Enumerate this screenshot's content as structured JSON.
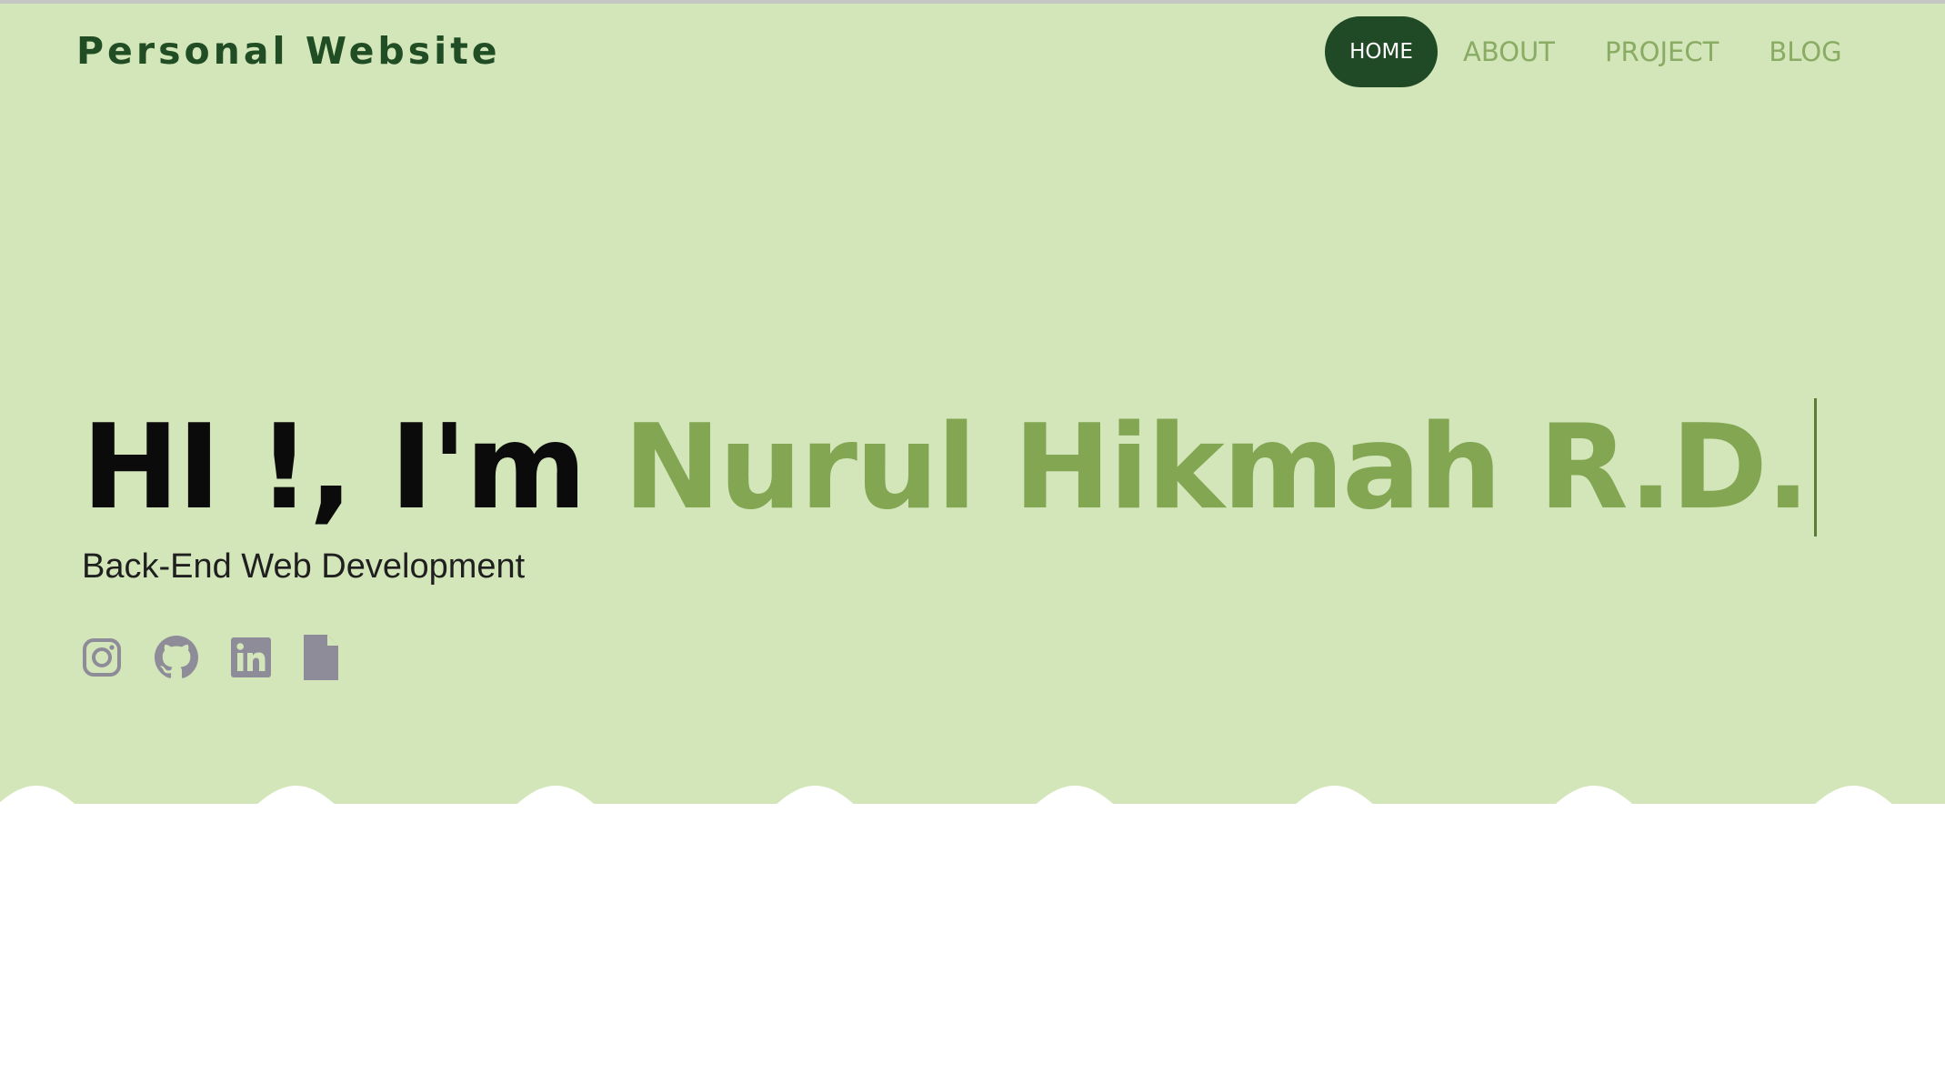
{
  "brand": {
    "title": "Personal Website"
  },
  "nav": {
    "items": [
      {
        "label": "HOME",
        "active": true
      },
      {
        "label": "ABOUT",
        "active": false
      },
      {
        "label": "PROJECT",
        "active": false
      },
      {
        "label": "BLOG",
        "active": false
      }
    ]
  },
  "hero": {
    "greeting": "HI !, I'm ",
    "name": "Nurul Hikmah R.D.",
    "subtitle": "Back-End Web Development"
  },
  "socials": [
    {
      "icon": "instagram-icon"
    },
    {
      "icon": "github-icon"
    },
    {
      "icon": "linkedin-icon"
    },
    {
      "icon": "file-icon"
    }
  ],
  "colors": {
    "hero_background": "#d3e6b9",
    "brand_dark": "#214d25",
    "accent_green": "#83a653",
    "nav_inactive": "#8aab63",
    "icon_gray": "#8e8c99"
  }
}
